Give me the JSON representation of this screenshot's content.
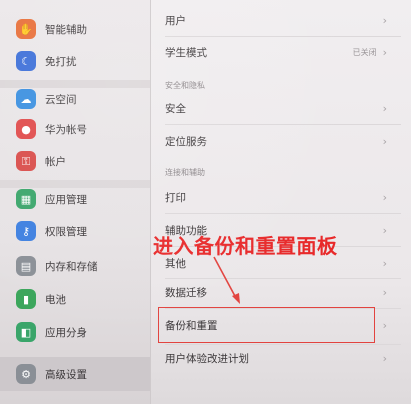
{
  "sidebar": {
    "items": [
      {
        "label": "智能辅助",
        "icon": "assist-icon",
        "color": "#e8703a",
        "glyph": "✋"
      },
      {
        "label": "免打扰",
        "icon": "moon-icon",
        "color": "#3d6fd8",
        "glyph": "☾"
      },
      {
        "label": "云空间",
        "icon": "cloud-icon",
        "color": "#3a8fe0",
        "glyph": "☁"
      },
      {
        "label": "华为帐号",
        "icon": "account-icon",
        "color": "#e04a4a",
        "glyph": "●"
      },
      {
        "label": "帐户",
        "icon": "key-icon",
        "color": "#d94c49",
        "glyph": "⚿"
      },
      {
        "label": "应用管理",
        "icon": "app-manage-icon",
        "color": "#3aa56a",
        "glyph": "▦"
      },
      {
        "label": "权限管理",
        "icon": "permission-icon",
        "color": "#3d7fe0",
        "glyph": "⚷"
      },
      {
        "label": "内存和存储",
        "icon": "storage-icon",
        "color": "#8a8f96",
        "glyph": "▤"
      },
      {
        "label": "电池",
        "icon": "battery-icon",
        "color": "#3aa55a",
        "glyph": "▮"
      },
      {
        "label": "应用分身",
        "icon": "app-twin-icon",
        "color": "#3aa56a",
        "glyph": "◧"
      },
      {
        "label": "高级设置",
        "icon": "gear-icon",
        "color": "#8a8f96",
        "glyph": "⚙"
      }
    ]
  },
  "main": {
    "rows": [
      {
        "label": "用户",
        "value": ""
      },
      {
        "label": "学生模式",
        "value": "已关闭"
      },
      {
        "label": "安全",
        "value": ""
      },
      {
        "label": "定位服务",
        "value": ""
      },
      {
        "label": "打印",
        "value": ""
      },
      {
        "label": "辅助功能",
        "value": ""
      },
      {
        "label": "其他",
        "value": ""
      },
      {
        "label": "数据迁移",
        "value": ""
      },
      {
        "label": "备份和重置",
        "value": ""
      },
      {
        "label": "用户体验改进计划",
        "value": ""
      }
    ],
    "headers": {
      "security": "安全和隐私",
      "connect": "连接和辅助"
    }
  },
  "annotation": {
    "callout": "进入备份和重置面板",
    "color": "#e8292a"
  }
}
